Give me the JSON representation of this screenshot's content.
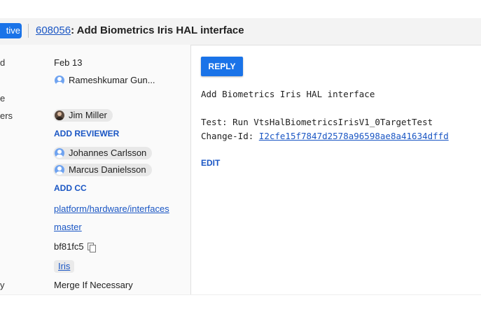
{
  "header": {
    "status_label": "tive",
    "change_number": "608056",
    "change_title": ": Add Biometrics Iris HAL interface"
  },
  "sidebar": {
    "labels": [
      "d",
      "e",
      "ers",
      "y"
    ],
    "updated": "Feb 13",
    "owner": "Rameshkumar Gun...",
    "reviewer": "Jim Miller",
    "add_reviewer": "ADD REVIEWER",
    "cc": [
      "Johannes Carlsson",
      "Marcus Danielsson"
    ],
    "add_cc": "ADD CC",
    "repo": "platform/hardware/interfaces",
    "branch": "master",
    "parent": "bf81fc5",
    "topic": "Iris",
    "strategy": "Merge If Necessary"
  },
  "main": {
    "reply_label": "REPLY",
    "message_line1": "Add Biometrics Iris HAL interface",
    "message_line2": "Test: Run VtsHalBiometricsIrisV1_0TargetTest",
    "change_id_label": "Change-Id: ",
    "change_id": "I2cfe15f7847d2578a96598ae8a41634dffd",
    "edit_label": "EDIT"
  },
  "colors": {
    "accent": "#1a73e8",
    "link": "#1a56c4"
  }
}
